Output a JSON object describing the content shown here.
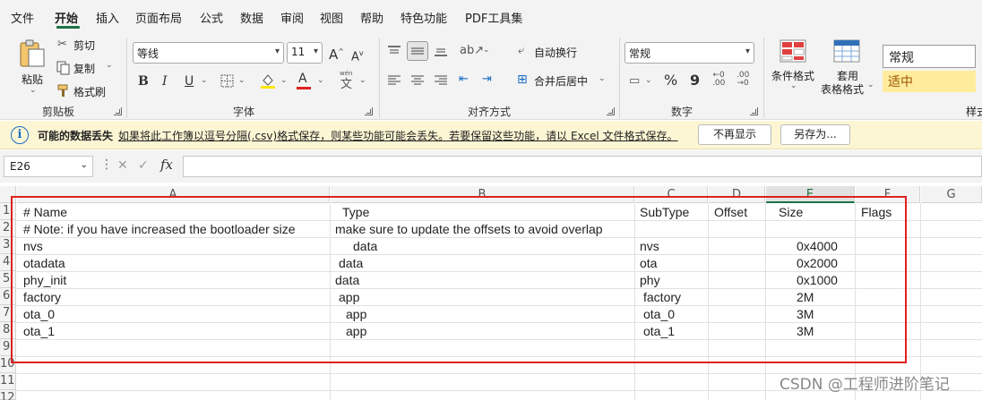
{
  "menu": {
    "items": [
      "文件",
      "开始",
      "插入",
      "页面布局",
      "公式",
      "数据",
      "审阅",
      "视图",
      "帮助",
      "特色功能",
      "PDF工具集"
    ],
    "active": "开始"
  },
  "ribbon": {
    "clipboard": {
      "paste": "粘贴",
      "cut": "剪切",
      "copy": "复制",
      "format_painter": "格式刷",
      "group_label": "剪贴板"
    },
    "font": {
      "font_name": "等线",
      "font_size": "11",
      "bold": "B",
      "italic": "I",
      "underline": "U",
      "increase_font": "A",
      "decrease_font": "A",
      "font_color_glyph": "A",
      "phonetic_top": "wén",
      "phonetic_glyph": "文",
      "group_label": "字体"
    },
    "alignment": {
      "wrap_text": "自动换行",
      "merge_center": "合并后居中",
      "group_label": "对齐方式"
    },
    "number": {
      "format": "常规",
      "percent": "%",
      "comma": "9",
      "group_label": "数字"
    },
    "styles": {
      "conditional_format": "条件格式",
      "table_format_line1": "套用",
      "table_format_line2": "表格格式",
      "style_normal": "常规",
      "style_neutral": "适中",
      "group_label_partial": "样式"
    },
    "colors": {
      "accent_green": "#1e7145",
      "highlight_yellow": "#ffe600",
      "font_red": "#e02020",
      "neutral_style_bg": "#ffeb9c",
      "neutral_style_text": "#9c5700"
    }
  },
  "infobar": {
    "icon": "info-icon",
    "title": "可能的数据丢失",
    "message": "如果将此工作簿以逗号分隔(.csv)格式保存，则某些功能可能会丢失。若要保留这些功能，请以 Excel 文件格式保存。",
    "dont_show_again": "不再显示",
    "save_as": "另存为..."
  },
  "formula_bar": {
    "name_box": "E26",
    "fx": "fx",
    "formula": ""
  },
  "sheet": {
    "columns": [
      "A",
      "B",
      "C",
      "D",
      "E",
      "F",
      "G"
    ],
    "selected_column": "E",
    "row_numbers": [
      "1",
      "2",
      "3",
      "4",
      "5",
      "6",
      "7",
      "8",
      "9",
      "10",
      "11",
      "12"
    ],
    "rows": [
      [
        "# Name",
        "Type",
        "SubType",
        "Offset",
        "Size",
        "Flags"
      ],
      [
        "# Note: if you have increased the bootloader size",
        "make sure to update the offsets to avoid overlap",
        "",
        "",
        "",
        ""
      ],
      [
        "nvs",
        "data",
        "nvs",
        "",
        "0x4000",
        ""
      ],
      [
        "otadata",
        "data",
        "ota",
        "",
        "0x2000",
        ""
      ],
      [
        "phy_init",
        "data",
        "phy",
        "",
        "0x1000",
        ""
      ],
      [
        "factory",
        "app",
        "factory",
        "",
        "2M",
        ""
      ],
      [
        "ota_0",
        "app",
        "ota_0",
        "",
        "3M",
        ""
      ],
      [
        "ota_1",
        "app",
        "ota_1",
        "",
        "3M",
        ""
      ]
    ]
  },
  "watermark": "CSDN @工程师进阶笔记"
}
